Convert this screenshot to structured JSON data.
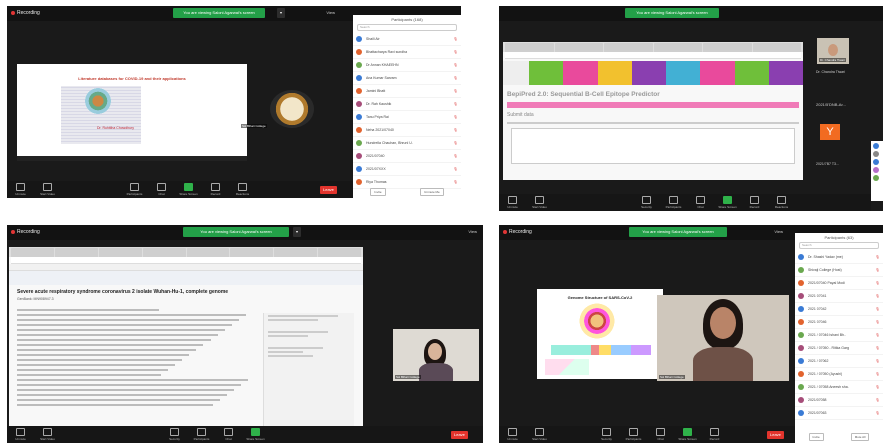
{
  "panel1": {
    "recording": "Recording",
    "share_banner": "You are viewing Saloni Agarwal's screen",
    "view_label": "View",
    "slide": {
      "title": "Literature databases for COVID-19 and their applications",
      "author": "Dr. Ruhitiha Chowdhury"
    },
    "presenter_tag": "Ssl Bihari College",
    "participants": {
      "title": "Participants (168)",
      "search": "Search",
      "people": [
        {
          "name": "Shaili Air",
          "color": "#3a7bd5"
        },
        {
          "name": "Bhattacharya Ravi sundha",
          "color": "#e2632e"
        },
        {
          "name": "Dr Annan KHAEEHN",
          "color": "#6aa84f"
        },
        {
          "name": "Ana Kumar Sarvam",
          "color": "#3a7bd5"
        },
        {
          "name": "Jamini Bhatt",
          "color": "#e2632e"
        },
        {
          "name": "Dr. Rah Kaushik",
          "color": "#a64d79"
        },
        {
          "name": "Tanu Priya Rai",
          "color": "#3a7bd5"
        },
        {
          "name": "Neha 2021/07040",
          "color": "#e2632e"
        },
        {
          "name": "Hundrella Chauhan, Bhrunl U.",
          "color": "#6aa84f"
        },
        {
          "name": "2021/07040",
          "color": "#a64d79"
        },
        {
          "name": "2021/07XXX",
          "color": "#3a7bd5"
        },
        {
          "name": "Riya Thomas",
          "color": "#e2632e"
        }
      ],
      "invite": "Invite",
      "unmute_me": "Unmute Me"
    },
    "toolbar": [
      "Unmute",
      "Start Video",
      "Participants",
      "Chat",
      "Share Screen",
      "Record",
      "Reactions"
    ],
    "end": "Leave"
  },
  "panel2": {
    "share_banner": "You are viewing Saloni Agarwal's screen",
    "heading": "BepiPred 2.0: Sequential B-Cell Epitope Predictor",
    "submit": "Submit data",
    "videos": [
      {
        "name": "Dr. Chandra Tiwari"
      },
      {
        "name": "2021/5'DNB-Ar..."
      },
      {
        "letter": "Y",
        "name": "2021/7B7 T3..."
      }
    ],
    "toolbar": [
      "Unmute",
      "Start Video",
      "Security",
      "Participants",
      "Chat",
      "Share Screen",
      "Record",
      "Reactions"
    ],
    "end": "Leave"
  },
  "panel3": {
    "recording": "Recording",
    "share_banner": "You are viewing Saloni Agarwal's screen",
    "view_label": "View",
    "record_title": "Severe acute respiratory syndrome coronavirus 2 isolate Wuhan-Hu-1, complete genome",
    "genbank": "GenBank: MN908947.3",
    "presenter_tag": "Ssl Bihari College",
    "toolbar": [
      "Unmute",
      "Start Video",
      "Security",
      "Participants",
      "Chat",
      "Share Screen"
    ],
    "end": "Leave"
  },
  "panel4": {
    "recording": "Recording",
    "share_banner": "You are viewing Saloni Agarwal's screen",
    "view_label": "View",
    "slide_title": "Genome Structure of SARS-CoV-2",
    "presenter_tag": "Ssl Bihari College",
    "participants": {
      "title": "Participants (63)",
      "search": "Search",
      "people": [
        {
          "name": "Dr. Shashi Yadav (me)",
          "color": "#3a7bd5"
        },
        {
          "name": "Shivaji College (Host)",
          "color": "#6aa84f"
        },
        {
          "name": "2021/07040 Payal Modi",
          "color": "#e2632e"
        },
        {
          "name": "2021 07041",
          "color": "#a64d79"
        },
        {
          "name": "2021 07042",
          "color": "#3a7bd5"
        },
        {
          "name": "2021 07046",
          "color": "#e2632e"
        },
        {
          "name": "2021 / 07046 Ishani Bh..",
          "color": "#6aa84f"
        },
        {
          "name": "2021 / 07050 - Ritika Garg",
          "color": "#a64d79"
        },
        {
          "name": "2021 / 07062",
          "color": "#3a7bd5"
        },
        {
          "name": "2021 / 07050 (Ayushi)",
          "color": "#e2632e"
        },
        {
          "name": "2021 / 07058 Aneesh sha.",
          "color": "#6aa84f"
        },
        {
          "name": "2021/07058",
          "color": "#a64d79"
        },
        {
          "name": "2021/07063",
          "color": "#3a7bd5"
        }
      ],
      "invite": "Invite",
      "mute_all": "Mute All"
    },
    "toolbar": [
      "Unmute",
      "Start Video",
      "Security",
      "Participants",
      "Chat",
      "Share Screen",
      "Record"
    ],
    "end": "Leave"
  }
}
